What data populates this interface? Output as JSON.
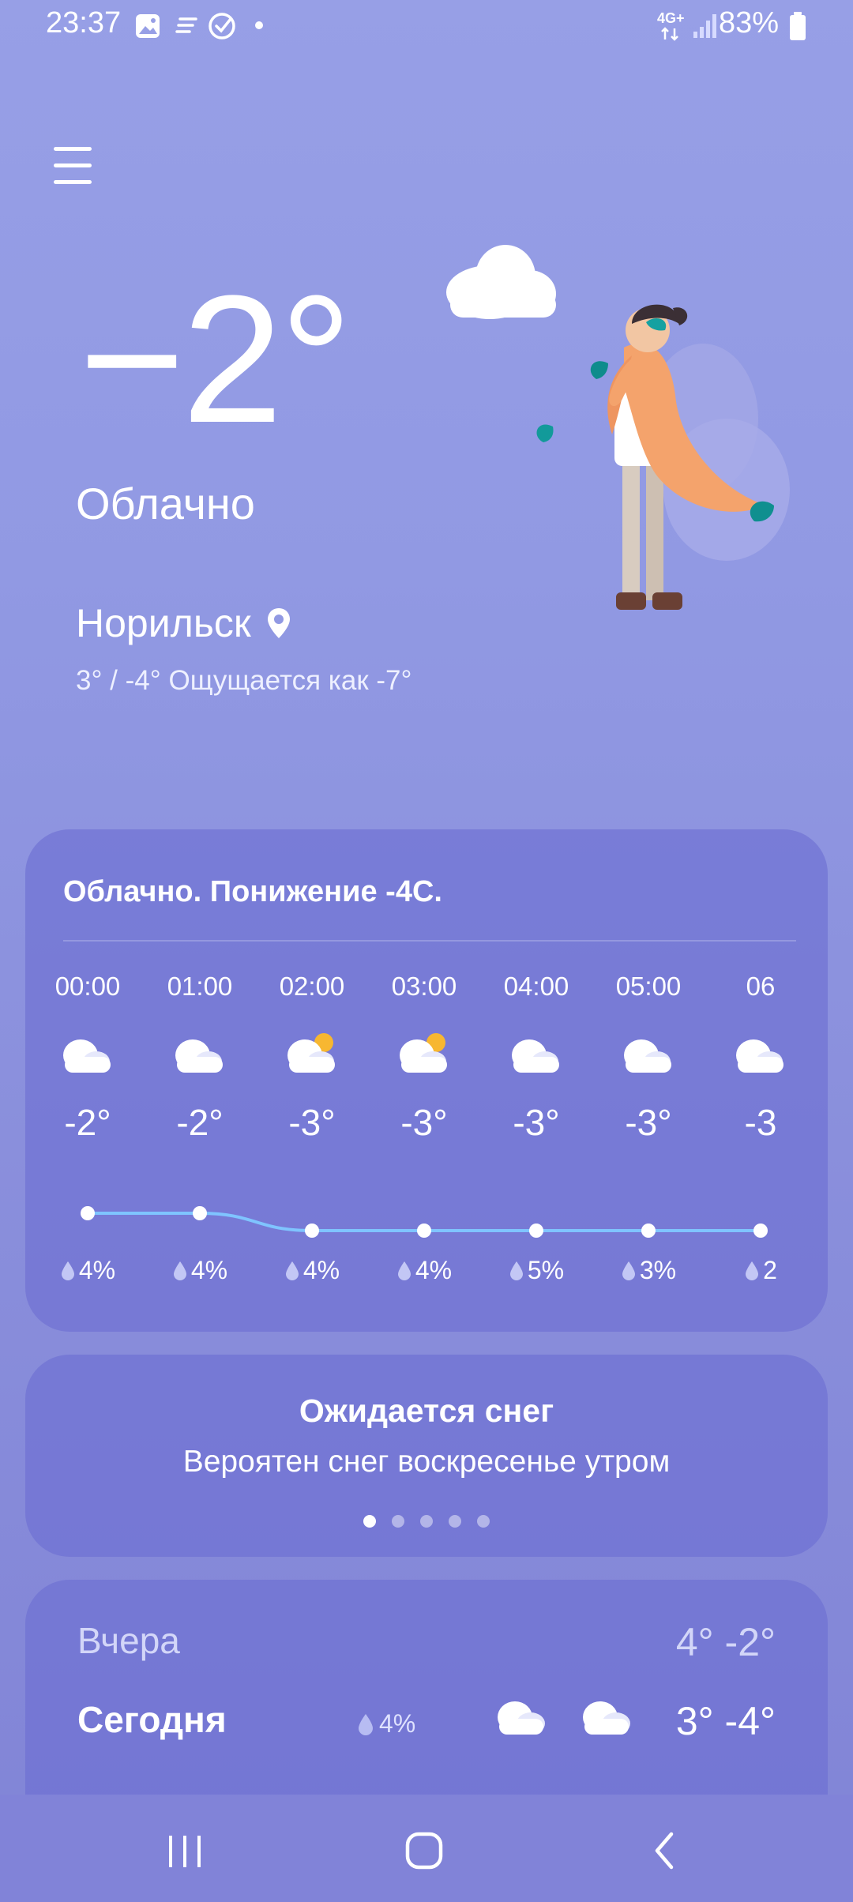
{
  "status_bar": {
    "time": "23:37",
    "network": "4G+",
    "battery": "83%",
    "icons": [
      "gallery-icon",
      "notes-icon",
      "check-circle-icon",
      "dot-icon",
      "signal-icon",
      "battery-icon"
    ]
  },
  "current": {
    "temperature": "−2°",
    "condition": "Облачно",
    "city": "Норильск",
    "range": "3° / -4° Ощущается как -7°"
  },
  "hourly": {
    "headline": "Облачно. Понижение -4C.",
    "hours": [
      {
        "time": "00:00",
        "temp": "-2°",
        "precip": "4%",
        "icon": "cloud-icon"
      },
      {
        "time": "01:00",
        "temp": "-2°",
        "precip": "4%",
        "icon": "cloud-icon"
      },
      {
        "time": "02:00",
        "temp": "-3°",
        "precip": "4%",
        "icon": "partly-sunny-icon"
      },
      {
        "time": "03:00",
        "temp": "-3°",
        "precip": "4%",
        "icon": "partly-sunny-icon"
      },
      {
        "time": "04:00",
        "temp": "-3°",
        "precip": "5%",
        "icon": "cloud-icon"
      },
      {
        "time": "05:00",
        "temp": "-3°",
        "precip": "3%",
        "icon": "cloud-icon"
      },
      {
        "time": "06",
        "temp": "-3",
        "precip": "2",
        "icon": "cloud-icon"
      }
    ]
  },
  "alert": {
    "title": "Ожидается снег",
    "text": "Вероятен снег воскресенье утром",
    "pages": 5,
    "active_page": 1
  },
  "daily": [
    {
      "day": "Вчера",
      "temps": "4° -2°"
    },
    {
      "day": "Сегодня",
      "precip": "4%",
      "temps": "3° -4°"
    }
  ],
  "colors": {
    "background": "#979fe6",
    "card": "#6c6ed2",
    "graph_line": "#7fc4ff",
    "sun": "#f7b731"
  }
}
